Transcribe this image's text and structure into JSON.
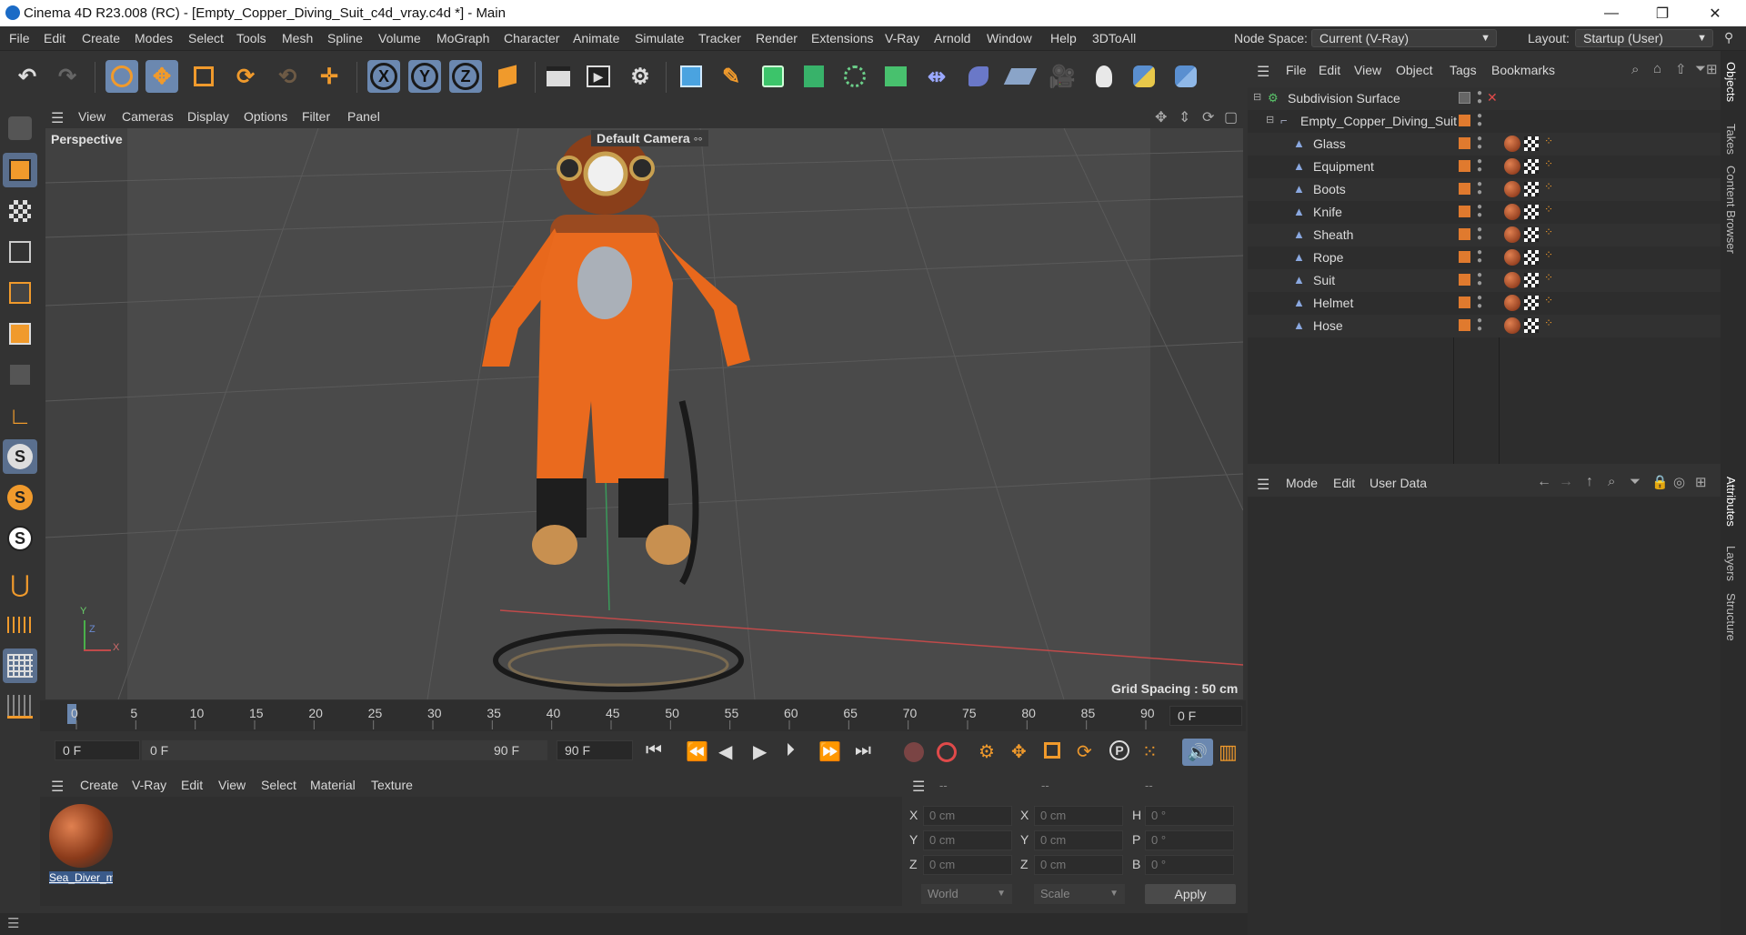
{
  "window": {
    "title": "Cinema 4D R23.008 (RC) - [Empty_Copper_Diving_Suit_c4d_vray.c4d *] - Main",
    "minimize": "—",
    "restore": "❐",
    "close": "✕"
  },
  "menubar": {
    "items": [
      "File",
      "Edit",
      "Create",
      "Modes",
      "Select",
      "Tools",
      "Mesh",
      "Spline",
      "Volume",
      "MoGraph",
      "Character",
      "Animate",
      "Simulate",
      "Tracker",
      "Render",
      "Extensions",
      "V-Ray",
      "Arnold",
      "Window",
      "Help",
      "3DToAll"
    ],
    "node_space_label": "Node Space:",
    "node_space_value": "Current (V-Ray)",
    "layout_label": "Layout:",
    "layout_value": "Startup (User)"
  },
  "toolbar": {
    "axis_x": "X",
    "axis_y": "Y",
    "axis_z": "Z"
  },
  "viewport": {
    "menu": [
      "View",
      "Cameras",
      "Display",
      "Options",
      "Filter",
      "Panel"
    ],
    "view_name": "Perspective",
    "camera_label": "Default Camera",
    "grid_spacing": "Grid Spacing : 50 cm",
    "axis_y": "Y",
    "axis_z": "Z",
    "axis_x": "X"
  },
  "timeline": {
    "ticks": [
      "0",
      "5",
      "10",
      "15",
      "20",
      "25",
      "30",
      "35",
      "40",
      "45",
      "50",
      "55",
      "60",
      "65",
      "70",
      "75",
      "80",
      "85",
      "90"
    ],
    "current_frame": "0 F"
  },
  "transport": {
    "start_field": "0 F",
    "range_start": "0 F",
    "range_end": "90 F",
    "end_field": "90 F"
  },
  "materials": {
    "menu": [
      "Create",
      "V-Ray",
      "Edit",
      "View",
      "Select",
      "Material",
      "Texture"
    ],
    "items": [
      {
        "name": "Sea_Diver_m"
      }
    ]
  },
  "coordinates": {
    "col_headers": [
      "--",
      "--",
      "--"
    ],
    "rows": [
      {
        "a": "X",
        "v1": "0 cm",
        "b": "X",
        "v2": "0 cm",
        "c": "H",
        "v3": "0 °"
      },
      {
        "a": "Y",
        "v1": "0 cm",
        "b": "Y",
        "v2": "0 cm",
        "c": "P",
        "v3": "0 °"
      },
      {
        "a": "Z",
        "v1": "0 cm",
        "b": "Z",
        "v2": "0 cm",
        "c": "B",
        "v3": "0 °"
      }
    ],
    "world": "World",
    "scale": "Scale",
    "apply": "Apply"
  },
  "objects": {
    "menu": [
      "File",
      "Edit",
      "View",
      "Object",
      "Tags",
      "Bookmarks"
    ],
    "tree": [
      {
        "name": "Subdivision Surface"
      },
      {
        "name": "Empty_Copper_Diving_Suit"
      },
      {
        "name": "Glass"
      },
      {
        "name": "Equipment"
      },
      {
        "name": "Boots"
      },
      {
        "name": "Knife"
      },
      {
        "name": "Sheath"
      },
      {
        "name": "Rope"
      },
      {
        "name": "Suit"
      },
      {
        "name": "Helmet"
      },
      {
        "name": "Hose"
      }
    ]
  },
  "attributes": {
    "menu": [
      "Mode",
      "Edit",
      "User Data"
    ]
  },
  "right_tabs": {
    "top": [
      "Objects",
      "Takes",
      "Content Browser"
    ],
    "bottom": [
      "Attributes",
      "Layers",
      "Structure"
    ]
  },
  "colors": {
    "accent_orange": "#e07a2e",
    "active_blue": "#6b88b0",
    "suit_orange": "#e8681c",
    "copper": "#8a3f1a"
  }
}
